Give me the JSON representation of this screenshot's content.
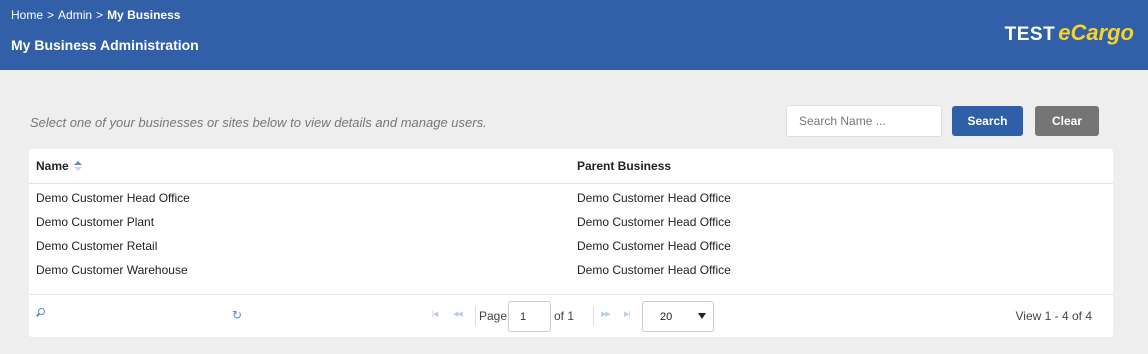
{
  "header": {
    "breadcrumb": [
      {
        "label": "Home"
      },
      {
        "label": "Admin"
      },
      {
        "label": "My Business"
      }
    ],
    "breadcrumb_separator": ">",
    "title": "My Business Administration",
    "logo": {
      "part1": "TEST",
      "part2": "eCargo"
    }
  },
  "instructions": "Select one of your businesses or sites below to view details and manage users.",
  "search": {
    "placeholder": "Search Name ...",
    "value": "",
    "search_label": "Search",
    "clear_label": "Clear"
  },
  "grid": {
    "columns": [
      {
        "label": "Name",
        "sort": "ascending"
      },
      {
        "label": "Parent Business"
      }
    ],
    "rows": [
      {
        "name": "Demo Customer Head Office",
        "parent": "Demo Customer Head Office"
      },
      {
        "name": "Demo Customer Plant",
        "parent": "Demo Customer Head Office"
      },
      {
        "name": "Demo Customer Retail",
        "parent": "Demo Customer Head Office"
      },
      {
        "name": "Demo Customer Warehouse",
        "parent": "Demo Customer Head Office"
      }
    ],
    "pager": {
      "page_label": "Page",
      "page_value": "1",
      "of_label": "of 1",
      "page_size": "20",
      "view_info": "View 1 - 4 of 4",
      "icons": [
        "search-icon",
        "refresh-icon",
        "first-page-icon",
        "prev-page-icon",
        "next-page-icon",
        "last-page-icon"
      ]
    }
  },
  "colors": {
    "header_bg": "#3160a8",
    "logo_accent": "#f6d32a",
    "search_button": "#2f5fa6",
    "clear_button": "#757575",
    "page_bg": "#eeeeee"
  }
}
